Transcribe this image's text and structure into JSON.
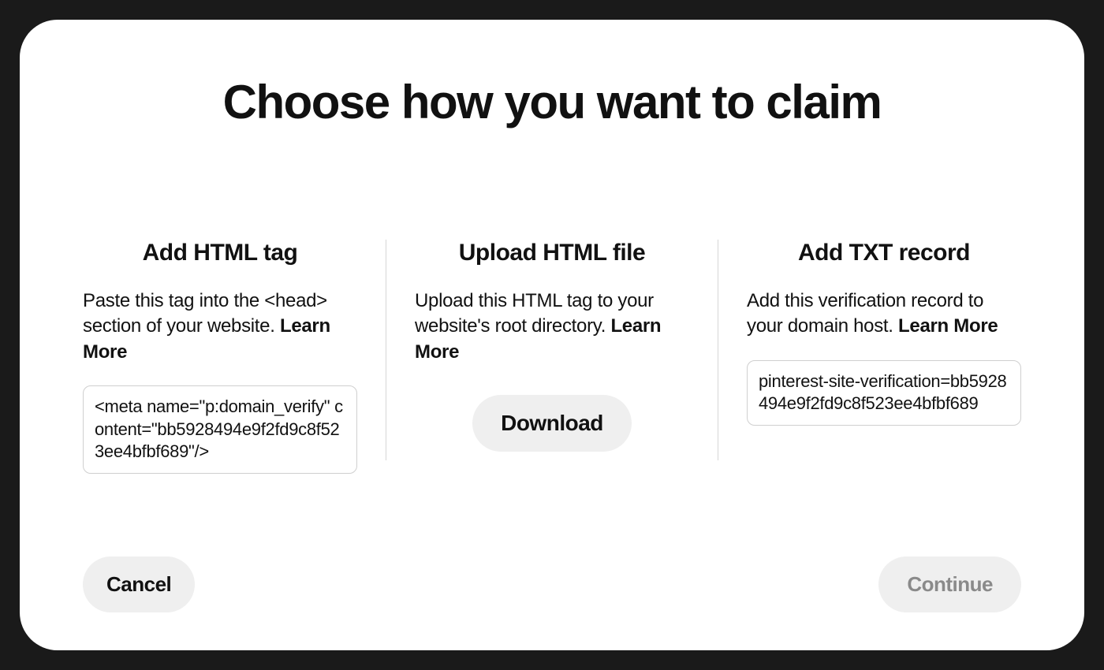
{
  "modal": {
    "title": "Choose how you want to claim",
    "options": {
      "html_tag": {
        "title": "Add HTML tag",
        "desc_pre": "Paste this tag into the <head> section of your website. ",
        "learn_more": "Learn More",
        "code": "<meta name=\"p:domain_verify\" content=\"bb5928494e9f2fd9c8f523ee4bfbf689\"/>"
      },
      "html_file": {
        "title": "Upload HTML file",
        "desc_pre": "Upload this HTML tag to your website's root directory. ",
        "learn_more": "Learn More",
        "download_label": "Download"
      },
      "txt_record": {
        "title": "Add TXT record",
        "desc_pre": "Add this verification record to your domain host. ",
        "learn_more": "Learn More",
        "code": "pinterest-site-verification=bb5928494e9f2fd9c8f523ee4bfbf689"
      }
    },
    "footer": {
      "cancel": "Cancel",
      "continue": "Continue"
    }
  }
}
